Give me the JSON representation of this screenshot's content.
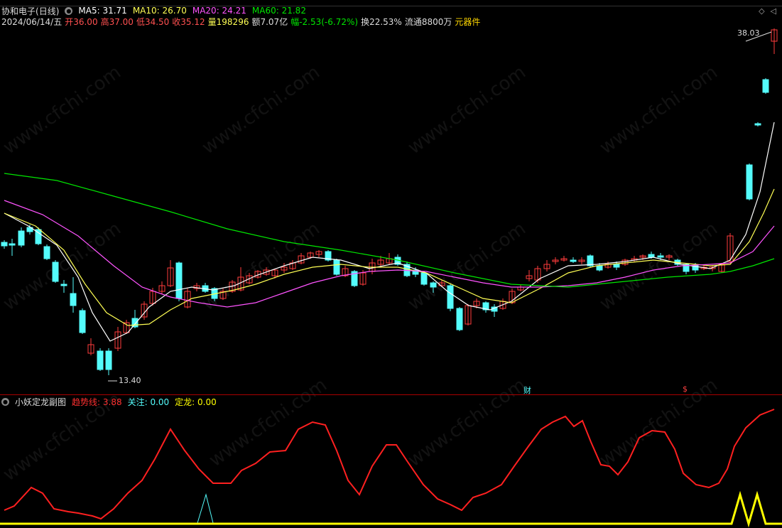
{
  "stock": {
    "name": "协和电子",
    "period": "(日线)",
    "ma5": "MA5: 31.71",
    "ma10": "MA10: 26.70",
    "ma20": "MA20: 24.21",
    "ma60": "MA60: 21.82"
  },
  "quote": {
    "date": "2024/06/14/五",
    "open": "开36.00",
    "high": "高37.00",
    "low": "低34.50",
    "close": "收35.12",
    "volume": "量198296",
    "amount": "额7.07亿",
    "change": "幅-2.53(-6.72%)",
    "turnover": "换22.53%",
    "float": "流通8800万",
    "sector": "元器件"
  },
  "annotations": {
    "high_label": "38.03",
    "low_label": "13.40",
    "fin_badge": "财",
    "dollar_badge": "$"
  },
  "indicator": {
    "name": "小妖定龙副图",
    "trend": "趋势线: 3.88",
    "focus": "关注: 0.00",
    "dragon": "定龙: 0.00"
  },
  "watermark": "www.cfchi.com",
  "colors": {
    "up": "#ff3c3c",
    "down": "#54fcfc",
    "ma5": "#ffffff",
    "ma10": "#ffff54",
    "ma20": "#ff54ff",
    "ma60": "#00e600",
    "trend": "#ff2020",
    "focus": "#54fcfc",
    "dragon": "#ffff00"
  }
}
